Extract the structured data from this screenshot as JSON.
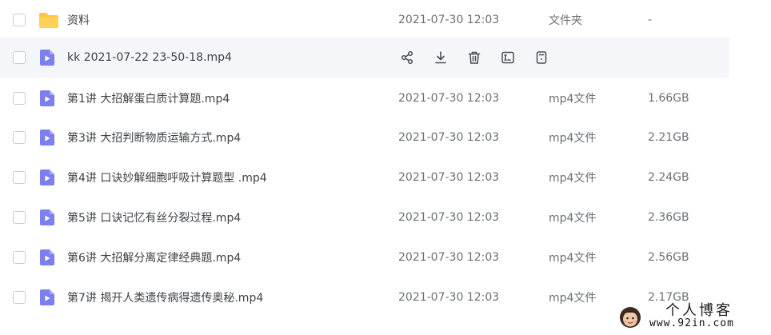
{
  "colors": {
    "accent": "#7b7ff0",
    "folder": "#ffc83d",
    "row_hover": "#f5f6fa",
    "text_primary": "#3f4247",
    "text_secondary": "#6b6f76"
  },
  "files": [
    {
      "name": "资料",
      "time": "2021-07-30 12:03",
      "type": "文件夹",
      "size": "-",
      "icon": "folder-icon"
    },
    {
      "name": "kk 2021-07-22 23-50-18.mp4",
      "icon": "video-file-icon",
      "hovered": true,
      "actions": [
        {
          "name": "share-icon"
        },
        {
          "name": "download-icon"
        },
        {
          "name": "delete-icon"
        },
        {
          "name": "rename-icon"
        },
        {
          "name": "more-icon"
        }
      ]
    },
    {
      "name": "第1讲 大招解蛋白质计算题.mp4",
      "time": "2021-07-30 12:03",
      "type": "mp4文件",
      "size": "1.66GB",
      "icon": "video-file-icon"
    },
    {
      "name": "第3讲 大招判断物质运输方式.mp4",
      "time": "2021-07-30 12:03",
      "type": "mp4文件",
      "size": "2.21GB",
      "icon": "video-file-icon"
    },
    {
      "name": "第4讲 口诀妙解细胞呼吸计算题型 .mp4",
      "time": "2021-07-30 12:03",
      "type": "mp4文件",
      "size": "2.24GB",
      "icon": "video-file-icon"
    },
    {
      "name": "第5讲 口诀记忆有丝分裂过程.mp4",
      "time": "2021-07-30 12:03",
      "type": "mp4文件",
      "size": "2.36GB",
      "icon": "video-file-icon"
    },
    {
      "name": "第6讲 大招解分离定律经典题.mp4",
      "time": "2021-07-30 12:03",
      "type": "mp4文件",
      "size": "2.56GB",
      "icon": "video-file-icon"
    },
    {
      "name": "第7讲 揭开人类遗传病得遗传奥秘.mp4",
      "time": "2021-07-30 12:03",
      "type": "mp4文件",
      "size": "2.17GB",
      "icon": "video-file-icon"
    }
  ],
  "watermark": {
    "title": "个人博客",
    "url": "www.92in.com"
  }
}
